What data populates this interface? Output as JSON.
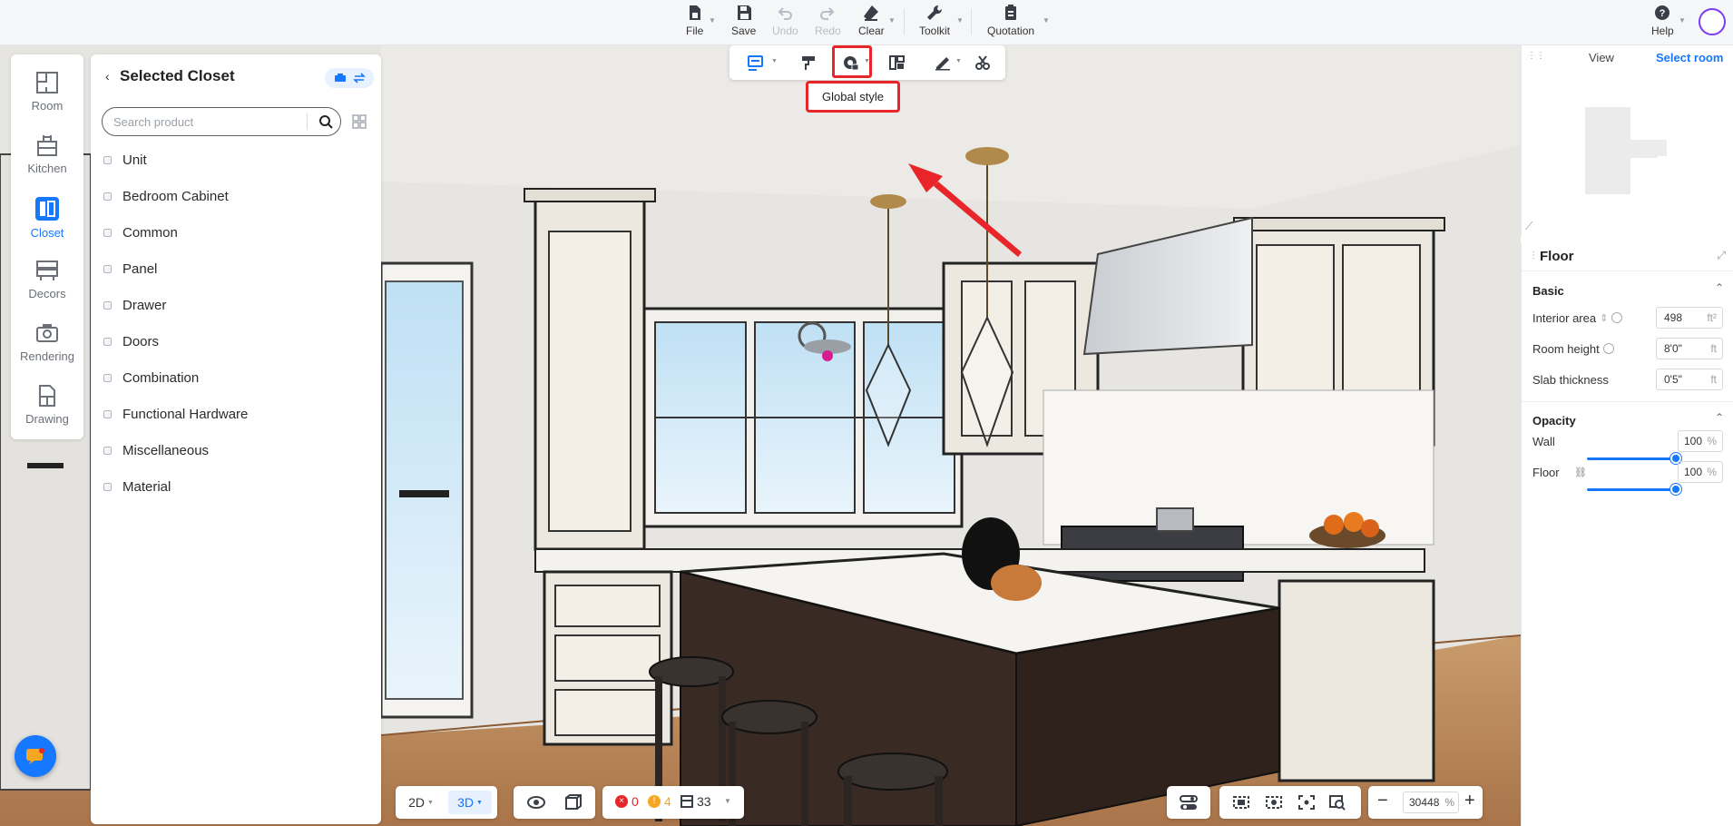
{
  "toolbar": {
    "file": "File",
    "save": "Save",
    "undo": "Undo",
    "redo": "Redo",
    "clear": "Clear",
    "toolkit": "Toolkit",
    "quotation": "Quotation",
    "help": "Help"
  },
  "leftnav": {
    "items": [
      {
        "label": "Room",
        "icon": "room-icon"
      },
      {
        "label": "Kitchen",
        "icon": "kitchen-icon"
      },
      {
        "label": "Closet",
        "icon": "closet-icon",
        "active": true
      },
      {
        "label": "Decors",
        "icon": "decors-icon"
      },
      {
        "label": "Rendering",
        "icon": "camera-icon"
      },
      {
        "label": "Drawing",
        "icon": "drawing-icon"
      }
    ]
  },
  "panel": {
    "title": "Selected Closet",
    "search_placeholder": "Search product",
    "categories": [
      "Unit",
      "Bedroom Cabinet",
      "Common",
      "Panel",
      "Drawer",
      "Doors",
      "Combination",
      "Functional Hardware",
      "Miscellaneous",
      "Material"
    ]
  },
  "viewport": {
    "tooltip": "Global style"
  },
  "right_panel": {
    "tabs": [
      "View",
      "Select room"
    ],
    "active_tab": "Select room",
    "title": "Floor",
    "basic": {
      "heading": "Basic",
      "rows": [
        {
          "label": "Interior area",
          "value": "498",
          "unit": "ft²"
        },
        {
          "label": "Room height",
          "value": "8'0\"",
          "unit": "ft"
        },
        {
          "label": "Slab thickness",
          "value": "0'5\"",
          "unit": "ft"
        }
      ]
    },
    "opacity": {
      "heading": "Opacity",
      "rows": [
        {
          "label": "Wall",
          "value": "100",
          "unit": "%",
          "level": 1.0
        },
        {
          "label": "Floor",
          "value": "100",
          "unit": "%",
          "level": 1.0
        }
      ]
    }
  },
  "bottom": {
    "view_2d": "2D",
    "view_3d": "3D",
    "errors": "0",
    "warnings": "4",
    "items": "33",
    "zoom": "30448",
    "zoom_unit": "%"
  },
  "colors": {
    "accent": "#1677ff",
    "highlight": "#e8262a"
  }
}
